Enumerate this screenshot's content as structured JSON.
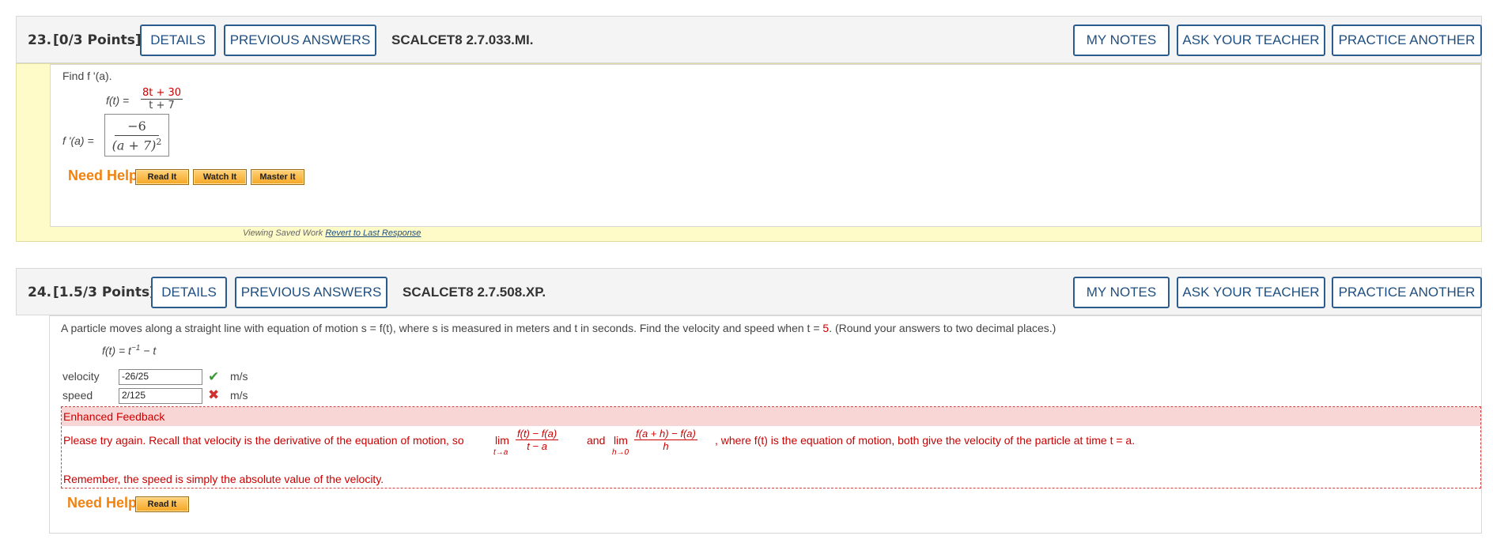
{
  "q23": {
    "number": "23.",
    "points": "[0/3 Points]",
    "buttons": {
      "details": "DETAILS",
      "previous": "PREVIOUS ANSWERS",
      "notes": "MY NOTES",
      "ask": "ASK YOUR TEACHER",
      "practice": "PRACTICE ANOTHER"
    },
    "code": "SCALCET8 2.7.033.MI.",
    "prompt": "Find f '(a).",
    "fn_lhs": "f(t) =",
    "fn_num": "8t + 30",
    "fn_den": "t + 7",
    "answer_lhs": "f '(a) =",
    "answer_num": "−6",
    "answer_den": "(a + 7)",
    "answer_exp": "2",
    "help_title": "Need Help?",
    "help_buttons": [
      "Read It",
      "Watch It",
      "Master It"
    ],
    "saved_text": "Viewing Saved Work",
    "revert_link": "Revert to Last Response"
  },
  "q24": {
    "number": "24.",
    "points": "[1.5/3 Points]",
    "buttons": {
      "details": "DETAILS",
      "previous": "PREVIOUS ANSWERS",
      "notes": "MY NOTES",
      "ask": "ASK YOUR TEACHER",
      "practice": "PRACTICE ANOTHER"
    },
    "code": "SCALCET8 2.7.508.XP.",
    "prompt_a": "A particle moves along a straight line with equation of motion s = f(t), where s is measured in meters and t in seconds. Find the velocity and speed when t = ",
    "prompt_t": "5",
    "prompt_b": ". (Round your answers to two decimal places.)",
    "fn": "f(t) = t",
    "fn_exp": "−1",
    "fn_tail": " − t",
    "velocity_label": "velocity",
    "velocity_value": "-26/25",
    "velocity_unit": "m/s",
    "speed_label": "speed",
    "speed_value": "2/125",
    "speed_unit": "m/s",
    "feedback_title": "Enhanced Feedback",
    "feedback_line1_a": "Please try again. Recall that velocity is the derivative of the equation of motion, so",
    "lim": "lim",
    "lim1_sub": "t→a",
    "lim1_num": "f(t) − f(a)",
    "lim1_den": "t − a",
    "and": "and",
    "lim2_sub": "h→0",
    "lim2_num": "f(a + h) − f(a)",
    "lim2_den": "h",
    "feedback_line1_b": ", where  f(t)  is the equation of motion, both give the velocity of the particle at time  t = a.",
    "feedback_line2": "Remember, the speed is simply the absolute value of the velocity.",
    "help_title": "Need Help?",
    "help_buttons": [
      "Read It"
    ]
  },
  "colors": {
    "accent_blue": "#1f4f80",
    "help_orange": "#f0820f",
    "feedback_red": "#cc0000",
    "check_green": "#3a9a3a"
  }
}
